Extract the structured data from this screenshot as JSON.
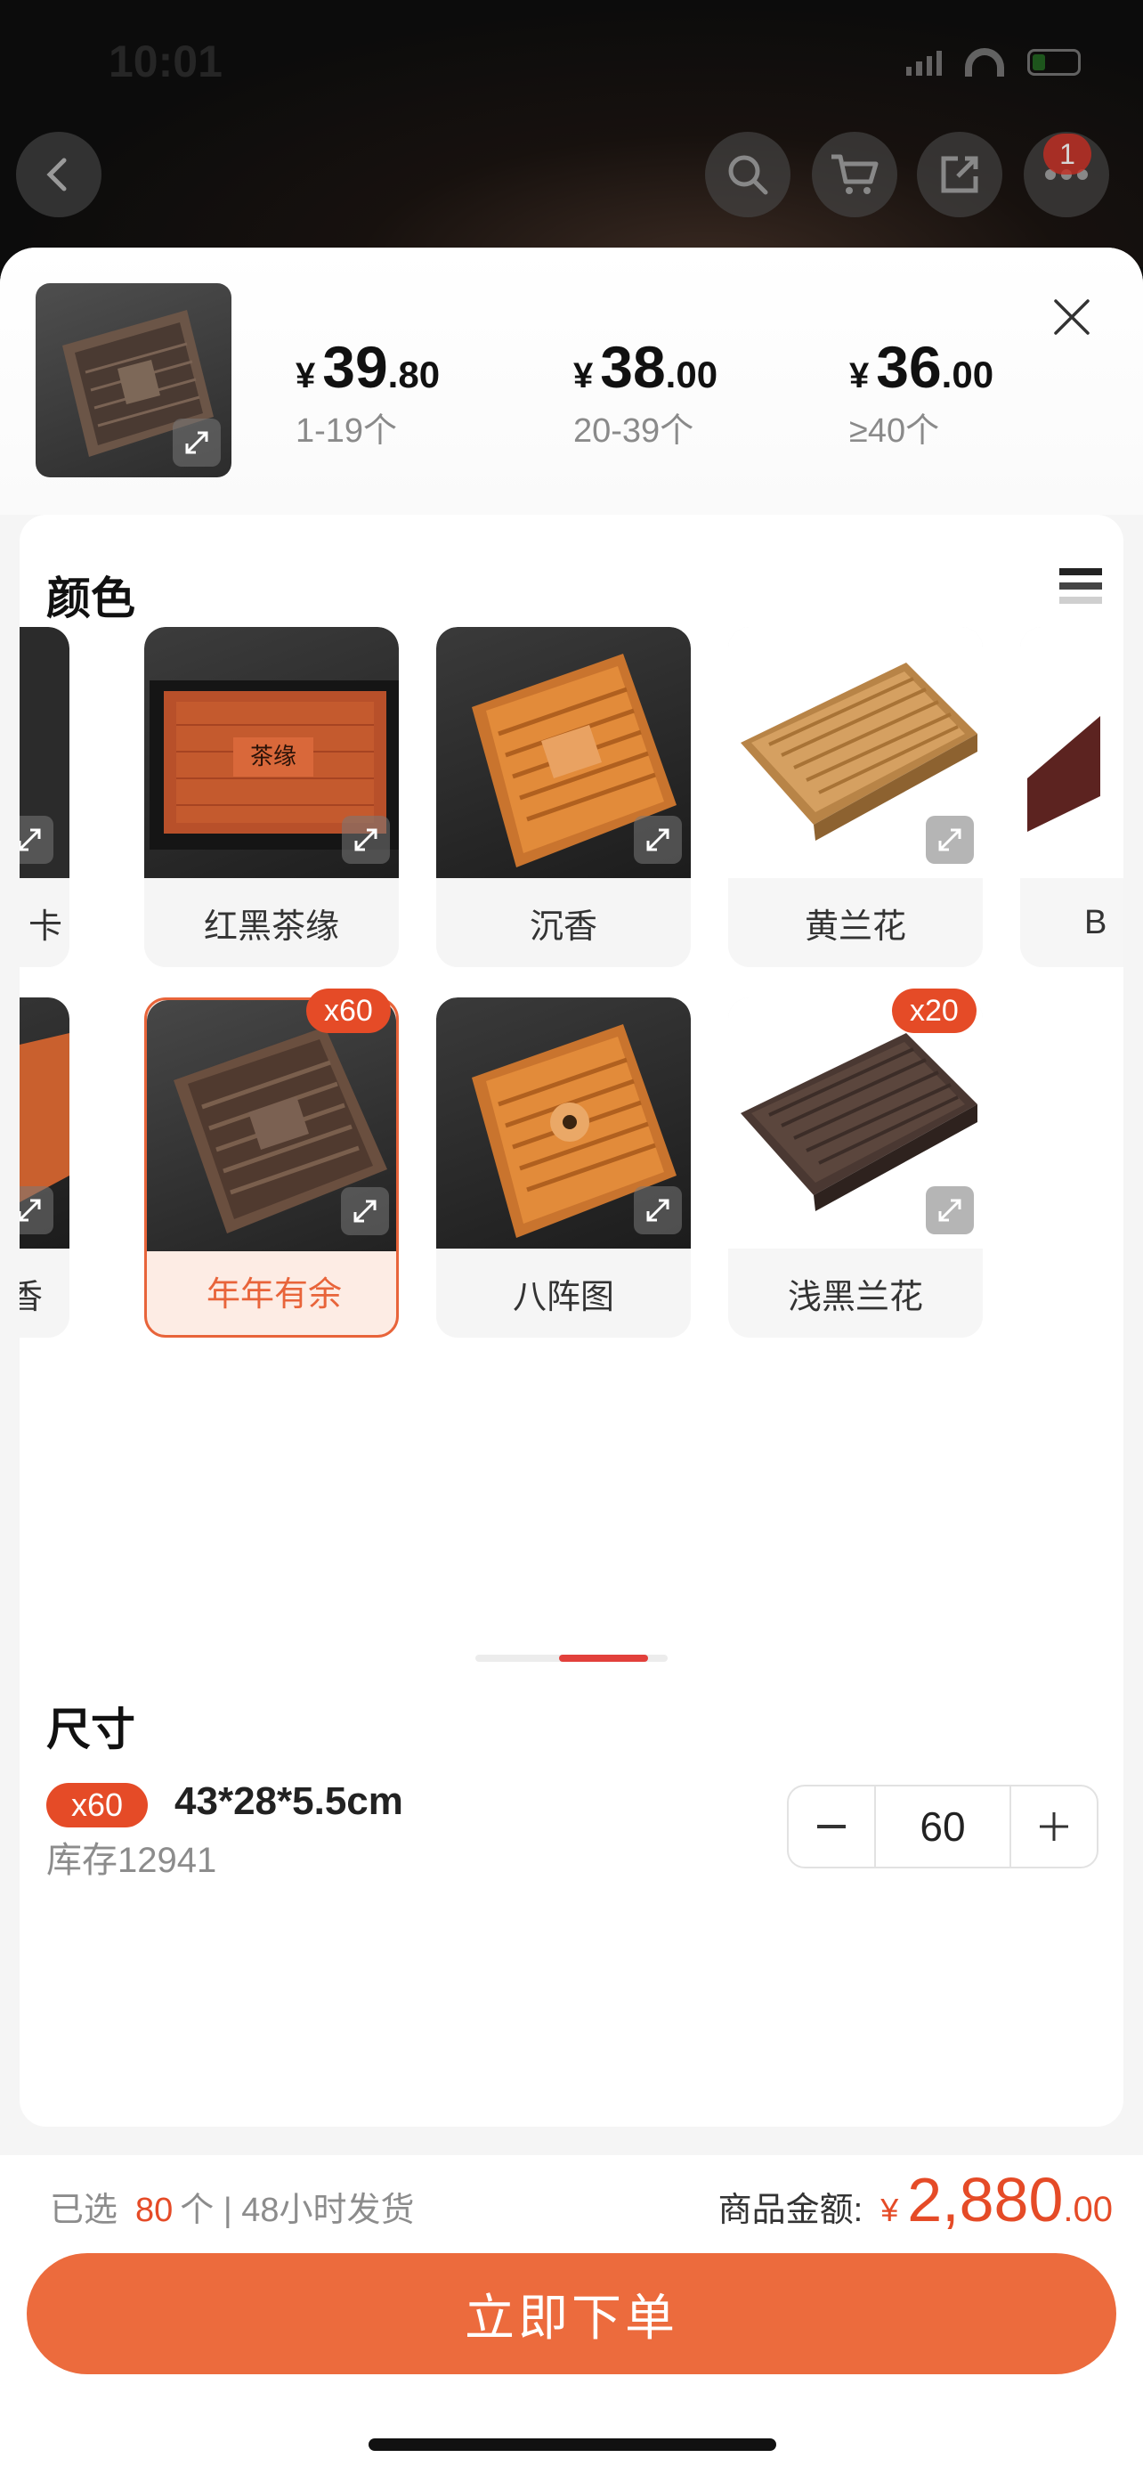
{
  "status": {
    "time": "10:01"
  },
  "nav": {
    "badge_count": "1"
  },
  "price_tiers": [
    {
      "yen": "¥",
      "int": "39",
      "dec": ".80",
      "range": "1-19个"
    },
    {
      "yen": "¥",
      "int": "38",
      "dec": ".00",
      "range": "20-39个"
    },
    {
      "yen": "¥",
      "int": "36",
      "dec": ".00",
      "range": "≥40个"
    }
  ],
  "color_section": {
    "title": "颜色",
    "swatches": [
      {
        "label": "",
        "partial": true
      },
      {
        "label": "红黑茶缘",
        "tone": "red-black"
      },
      {
        "label": "沉香",
        "tone": "orange"
      },
      {
        "label": "黄兰花",
        "tone": "light"
      },
      {
        "label": "В",
        "partial": true
      },
      {
        "label": "香",
        "partial": true
      },
      {
        "label": "年年有余",
        "tone": "dark-brown",
        "selected": true,
        "qty_badge": "x60"
      },
      {
        "label": "八阵图",
        "tone": "orange"
      },
      {
        "label": "浅黑兰花",
        "tone": "dark-light",
        "qty_badge": "x20"
      }
    ],
    "partial_left_label": "卡",
    "partial_right_label": "B"
  },
  "size_section": {
    "title": "尺寸",
    "badge": "x60",
    "label": "43*28*5.5cm",
    "stock": "库存12941",
    "quantity": "60"
  },
  "footer": {
    "selected_prefix": "已选",
    "selected_count": "80",
    "selected_suffix": "个 | 48小时发货",
    "total_label": "商品金额:",
    "total_yen": "¥",
    "total_int": "2,880",
    "total_dec": ".00",
    "order_button": "立即下单"
  },
  "colors": {
    "accent": "#e54b27",
    "button": "#ec6b3d",
    "indicator": "#e2403b"
  }
}
